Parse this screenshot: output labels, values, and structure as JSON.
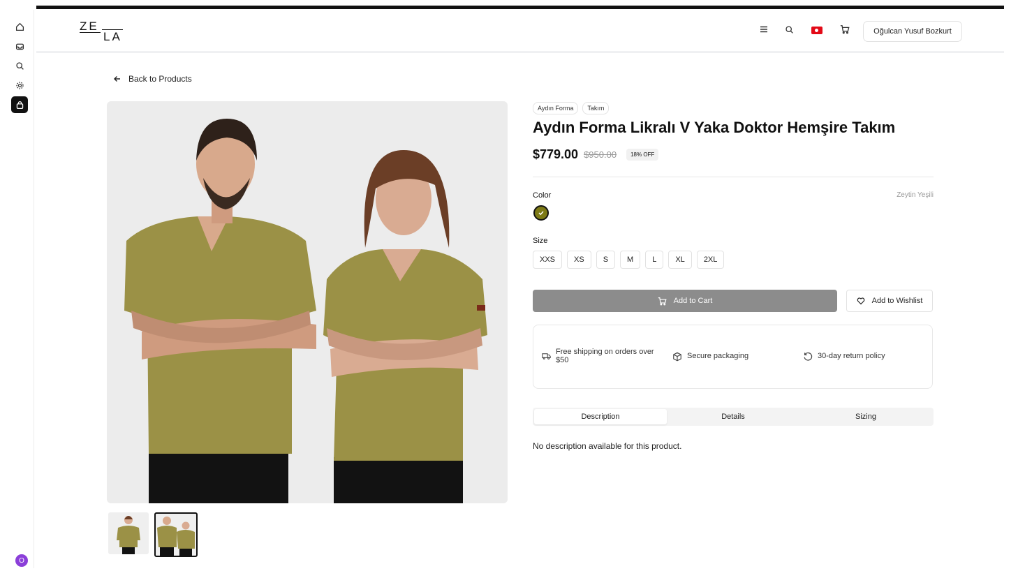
{
  "header": {
    "logo_top": "ZE",
    "logo_bottom": "LA",
    "user_name": "Oğulcan Yusuf Bozkurt"
  },
  "back_link": "Back to Products",
  "product": {
    "tags": [
      "Aydın Forma",
      "Takım"
    ],
    "title": "Aydın Forma Likralı V Yaka Doktor Hemşire Takım",
    "price": "$779.00",
    "old_price": "$950.00",
    "discount": "18% OFF",
    "color_label": "Color",
    "color_value": "Zeytin Yeşili",
    "color_swatch": "#7d7a16",
    "size_label": "Size",
    "sizes": [
      "XXS",
      "XS",
      "S",
      "M",
      "L",
      "XL",
      "2XL"
    ],
    "add_to_cart": "Add to Cart",
    "add_to_wishlist": "Add to Wishlist",
    "features": [
      "Free shipping on orders over $50",
      "Secure packaging",
      "30-day return policy"
    ],
    "tabs": [
      "Description",
      "Details",
      "Sizing"
    ],
    "description": "No description available for this product."
  },
  "sidebar": {
    "avatar_letter": "O",
    "avatar_color": "#8b3fd9"
  }
}
